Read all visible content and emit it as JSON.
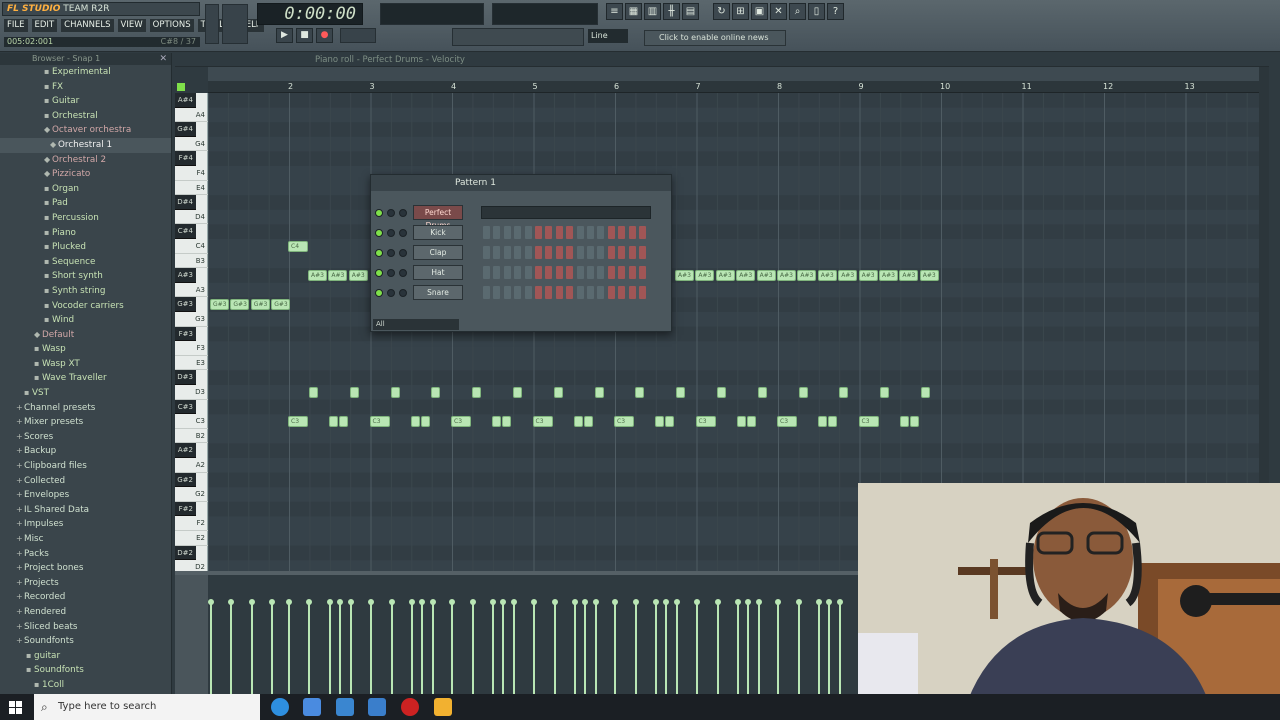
{
  "app": {
    "brand": "FL STUDIO",
    "title": "TEAM R2R",
    "menu": [
      "FILE",
      "EDIT",
      "CHANNELS",
      "VIEW",
      "OPTIONS",
      "TOOLS",
      "HELP"
    ],
    "hint_left": "005:02:001",
    "hint_right": "C#8 / 37"
  },
  "transport": {
    "time": "0:00:00",
    "line_mode": "Line",
    "news": "Click to enable online news"
  },
  "browser": {
    "header": "Browser - Snap 1",
    "items": [
      {
        "label": "Experimental",
        "kind": "folder",
        "indent": 56
      },
      {
        "label": "FX",
        "kind": "folder",
        "indent": 56
      },
      {
        "label": "Guitar",
        "kind": "folder",
        "indent": 56
      },
      {
        "label": "Orchestral",
        "kind": "folder",
        "indent": 56
      },
      {
        "label": "Octaver orchestra",
        "kind": "preset",
        "indent": 56
      },
      {
        "label": "Orchestral 1",
        "kind": "selected",
        "indent": 62
      },
      {
        "label": "Orchestral 2",
        "kind": "preset",
        "indent": 56
      },
      {
        "label": "Pizzicato",
        "kind": "preset",
        "indent": 56
      },
      {
        "label": "Organ",
        "kind": "folder",
        "indent": 56
      },
      {
        "label": "Pad",
        "kind": "folder",
        "indent": 56
      },
      {
        "label": "Percussion",
        "kind": "folder",
        "indent": 56
      },
      {
        "label": "Piano",
        "kind": "folder",
        "indent": 56
      },
      {
        "label": "Plucked",
        "kind": "folder",
        "indent": 56
      },
      {
        "label": "Sequence",
        "kind": "folder",
        "indent": 56
      },
      {
        "label": "Short synth",
        "kind": "folder",
        "indent": 56
      },
      {
        "label": "Synth string",
        "kind": "folder",
        "indent": 56
      },
      {
        "label": "Vocoder carriers",
        "kind": "folder",
        "indent": 56
      },
      {
        "label": "Wind",
        "kind": "folder",
        "indent": 56
      },
      {
        "label": "Default",
        "kind": "preset",
        "indent": 46
      },
      {
        "label": "Wasp",
        "kind": "folder",
        "indent": 46
      },
      {
        "label": "Wasp XT",
        "kind": "folder",
        "indent": 46
      },
      {
        "label": "Wave Traveller",
        "kind": "folder",
        "indent": 46
      },
      {
        "label": "VST",
        "kind": "folder",
        "indent": 36
      },
      {
        "label": "Channel presets",
        "kind": "cat",
        "indent": 28
      },
      {
        "label": "Mixer presets",
        "kind": "cat",
        "indent": 28
      },
      {
        "label": "Scores",
        "kind": "cat",
        "indent": 28
      },
      {
        "label": "Backup",
        "kind": "cat",
        "indent": 28
      },
      {
        "label": "Clipboard files",
        "kind": "cat",
        "indent": 28
      },
      {
        "label": "Collected",
        "kind": "cat",
        "indent": 28
      },
      {
        "label": "Envelopes",
        "kind": "cat",
        "indent": 28
      },
      {
        "label": "IL Shared Data",
        "kind": "cat",
        "indent": 28
      },
      {
        "label": "Impulses",
        "kind": "cat",
        "indent": 28
      },
      {
        "label": "Misc",
        "kind": "cat",
        "indent": 28
      },
      {
        "label": "Packs",
        "kind": "cat",
        "indent": 28
      },
      {
        "label": "Project bones",
        "kind": "cat",
        "indent": 28
      },
      {
        "label": "Projects",
        "kind": "cat",
        "indent": 28
      },
      {
        "label": "Recorded",
        "kind": "cat",
        "indent": 28
      },
      {
        "label": "Rendered",
        "kind": "cat",
        "indent": 28
      },
      {
        "label": "Sliced beats",
        "kind": "cat",
        "indent": 28
      },
      {
        "label": "Soundfonts",
        "kind": "cat",
        "indent": 28
      },
      {
        "label": "guitar",
        "kind": "folder",
        "indent": 38
      },
      {
        "label": "Soundfonts",
        "kind": "folder",
        "indent": 38
      },
      {
        "label": "1Coll",
        "kind": "folder",
        "indent": 46
      }
    ]
  },
  "piano_roll": {
    "title": "Piano roll - Perfect Drums - Velocity",
    "ruler": [
      "2",
      "3",
      "4",
      "5",
      "6",
      "7",
      "8",
      "9",
      "10",
      "11",
      "12",
      "13"
    ],
    "keys": [
      "A#4",
      "A4",
      "G#4",
      "G4",
      "F#4",
      "F4",
      "E4",
      "D#4",
      "D4",
      "C#4",
      "C4",
      "B3",
      "A#3",
      "A3",
      "G#3",
      "G3",
      "F#3",
      "F3",
      "E3",
      "D#3",
      "D3",
      "C#3",
      "C3",
      "B2",
      "A#2",
      "A2",
      "G#2",
      "G2",
      "F#2",
      "F2",
      "E2",
      "D#2",
      "D2"
    ],
    "note_labels": {
      "c4": "C4",
      "as3": "A#3",
      "gs3": "G#3",
      "c3": "C3"
    }
  },
  "channel_rack": {
    "title": "Pattern 1",
    "filter": "All",
    "channels": [
      {
        "name": "Perfect Drums",
        "type": "piano"
      },
      {
        "name": "Kick",
        "type": "steps"
      },
      {
        "name": "Clap",
        "type": "steps"
      },
      {
        "name": "Hat",
        "type": "steps"
      },
      {
        "name": "Snare",
        "type": "steps"
      }
    ]
  },
  "taskbar": {
    "search_placeholder": "Type here to search"
  },
  "colors": {
    "note": "#b9e6b4",
    "step_off": "#5a6a70",
    "step_red": "#a05656",
    "accent": "#ffb040"
  }
}
